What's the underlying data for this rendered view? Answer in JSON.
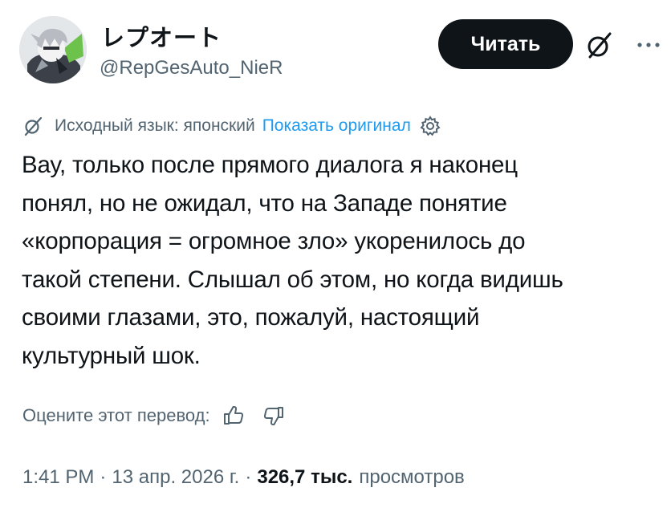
{
  "author": {
    "display_name": "レプオート",
    "handle": "@RepGesAuto_NieR"
  },
  "actions": {
    "follow_label": "Читать",
    "grok_icon": "grok-slash-icon",
    "more_icon": "more-dots-icon"
  },
  "translation": {
    "source_language": "Исходный язык: японский",
    "show_original": "Показать оригинал",
    "icon": "translate-slash-icon",
    "settings_icon": "gear-icon"
  },
  "tweet": {
    "text_lines": [
      "Вау, только после прямого диалога я наконец",
      "понял, но не ожидал, что на Западе понятие",
      "«корпорация = огромное зло» укоренилось до",
      "такой степени. Слышал об этом, но когда видишь",
      "своими глазами, это, пожалуй, настоящий",
      "культурный шок."
    ]
  },
  "rating": {
    "label": "Оцените этот перевод:",
    "up_icon": "thumbs-up-icon",
    "down_icon": "thumbs-down-icon"
  },
  "meta": {
    "time": "1:41 PM",
    "date": "13 апр. 2026 г.",
    "separator": "·",
    "views_count": "326,7 тыс.",
    "views_label": "просмотров"
  },
  "colors": {
    "text_primary": "#0f1419",
    "text_secondary": "#536471",
    "link": "#1d9bf0",
    "button_bg": "#0f1419",
    "button_text": "#ffffff"
  }
}
